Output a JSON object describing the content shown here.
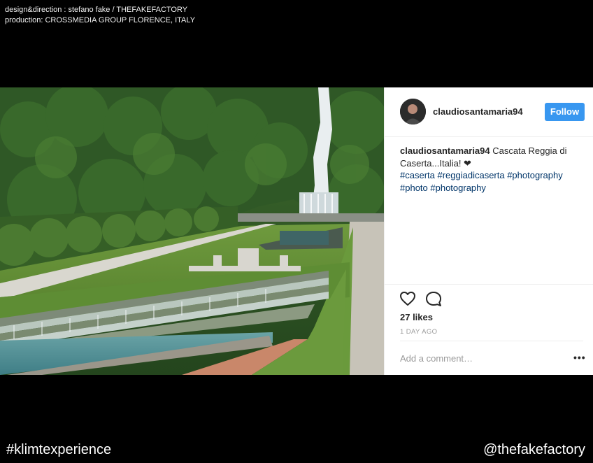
{
  "credits": {
    "line1": "design&direction : stefano fake / THEFAKEFACTORY",
    "line2": "production: CROSSMEDIA GROUP FLORENCE, ITALY"
  },
  "post": {
    "username": "claudiosantamaria94",
    "follow_label": "Follow",
    "caption_user": "claudiosantamaria94",
    "caption_text": " Cascata Reggia di Caserta...Italia! ❤",
    "tags_line1": "#caserta #reggiadicaserta #photography",
    "tags_line2": "#photo #photography",
    "likes": "27 likes",
    "time": "1 DAY AGO",
    "comment_placeholder": "Add a comment…",
    "more_label": "•••",
    "icons": [
      "heart-icon",
      "comment-icon",
      "more-options-icon"
    ],
    "colors": {
      "follow": "#3897f0",
      "hashtag": "#003569"
    }
  },
  "footer": {
    "hashtag": "#klimtexperience",
    "handle": "@thefakefactory"
  }
}
